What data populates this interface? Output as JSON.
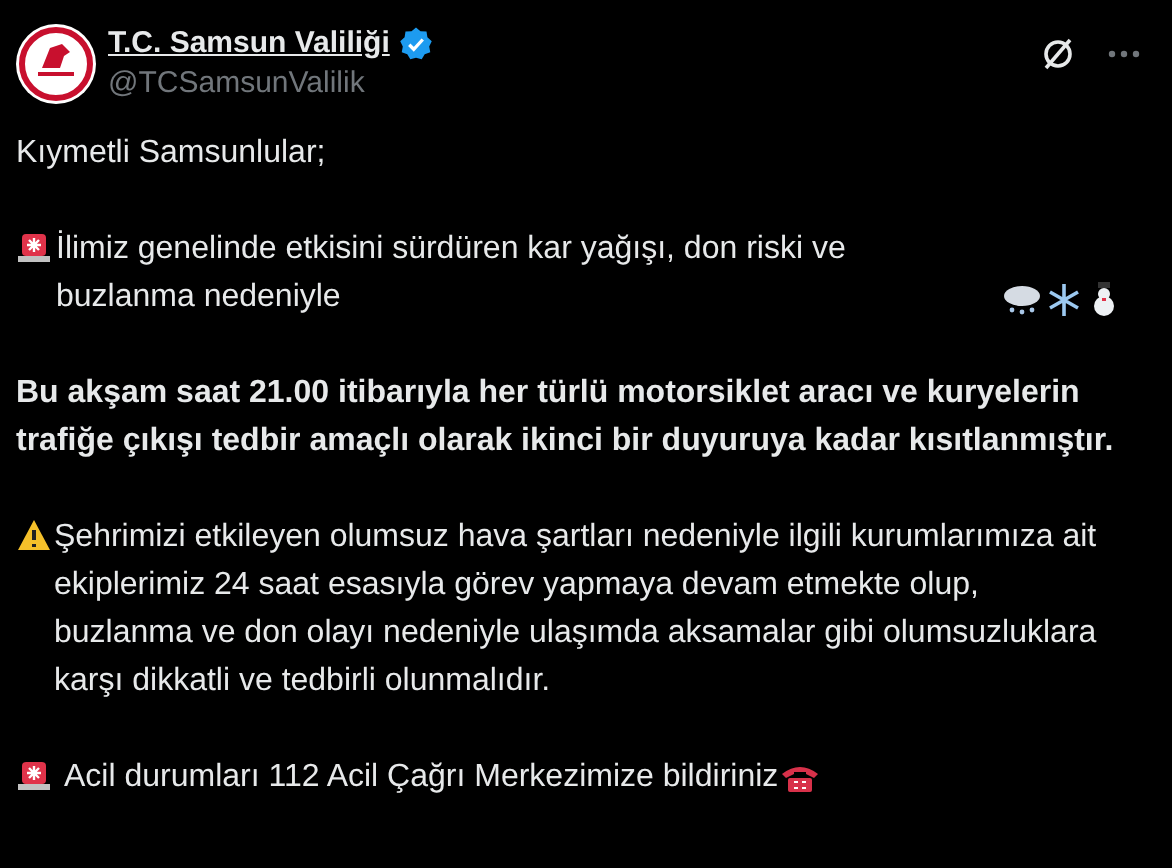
{
  "author": {
    "name": "T.C. Samsun Valiliği",
    "verified": true,
    "handle": "@TCSamsunValilik"
  },
  "paragraphs": [
    {
      "kind": "plain",
      "text": "Kıymetli Samsunlular;"
    },
    {
      "kind": "alert",
      "text": "İlimiz genelinde etkisini sürdüren kar yağışı, don riski ve buzlanma nedeniyle"
    },
    {
      "kind": "bold",
      "text": "Bu akşam saat 21.00 itibarıyla her türlü motorsiklet aracı ve kuryelerin trafiğe çıkışı tedbir amaçlı olarak ikinci bir duyuruya kadar kısıtlanmıştır."
    },
    {
      "kind": "warning",
      "text": "Şehrimizi etkileyen olumsuz hava şartları nedeniyle ilgili kurumlarımıza ait ekiplerimiz 24 saat esasıyla görev yapmaya devam etmekte olup, buzlanma ve don olayı nedeniyle ulaşımda aksamalar gibi olumsuzluklara karşı dikkatli ve tedbirli olunmalıdır."
    },
    {
      "kind": "emergency",
      "text": "Acil durumları 112 Acil Çağrı Merkezimize bildiriniz"
    }
  ]
}
